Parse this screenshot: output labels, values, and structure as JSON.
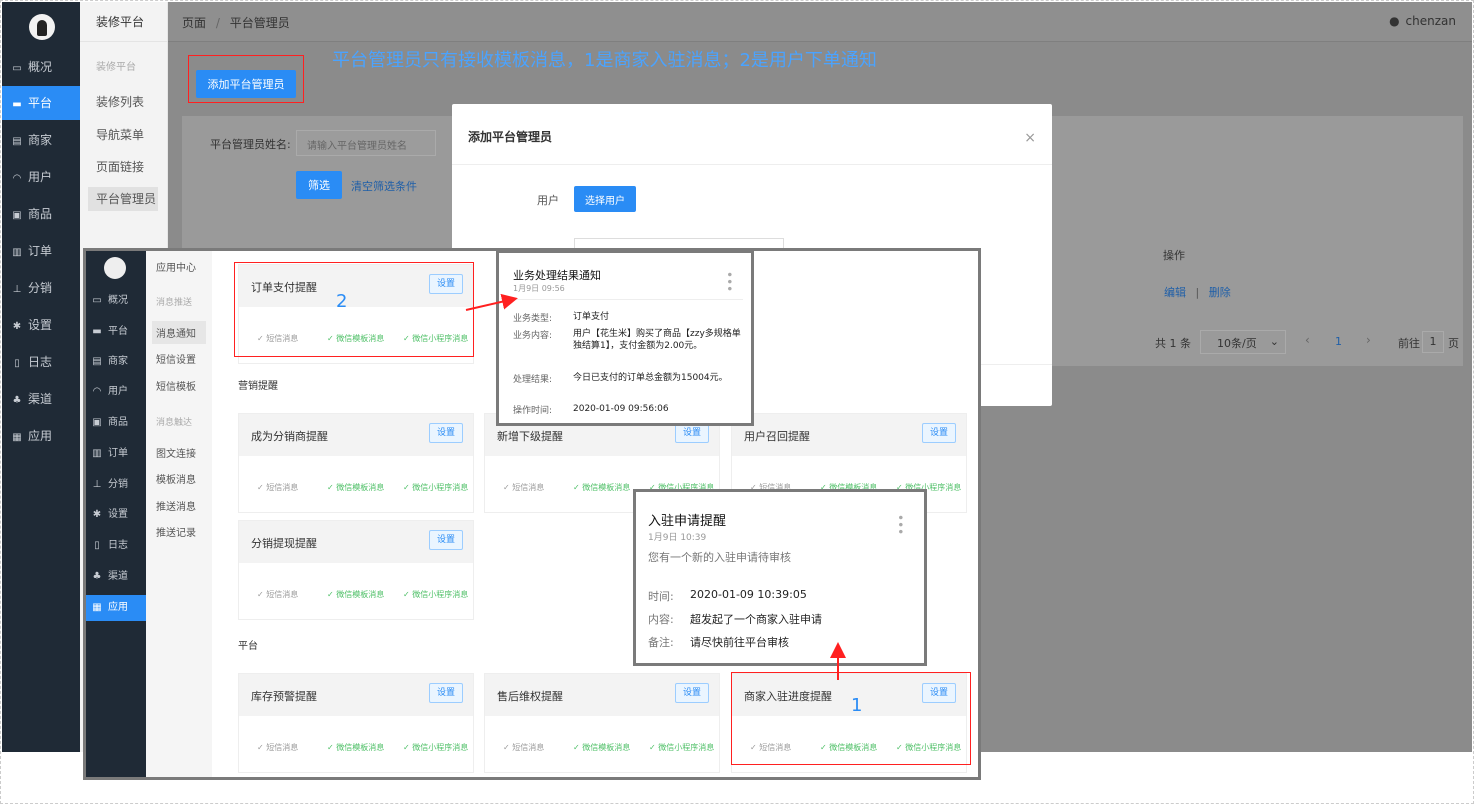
{
  "sidebar": {
    "items": [
      {
        "label": "概况",
        "icon": "monitor-icon"
      },
      {
        "label": "平台",
        "icon": "desktop-icon"
      },
      {
        "label": "商家",
        "icon": "store-icon"
      },
      {
        "label": "用户",
        "icon": "user-icon"
      },
      {
        "label": "商品",
        "icon": "box-icon"
      },
      {
        "label": "订单",
        "icon": "doc-icon"
      },
      {
        "label": "分销",
        "icon": "tree-icon"
      },
      {
        "label": "设置",
        "icon": "gear-icon"
      },
      {
        "label": "日志",
        "icon": "book-icon"
      },
      {
        "label": "渠道",
        "icon": "cluster-icon"
      },
      {
        "label": "应用",
        "icon": "grid-icon"
      }
    ]
  },
  "submenu": {
    "head": "装修平台",
    "group": "装修平台",
    "items": [
      "装修列表",
      "导航菜单",
      "页面链接",
      "平台管理员"
    ]
  },
  "breadcrumb": {
    "home": "页面",
    "sep": "/",
    "current": "平台管理员"
  },
  "user": {
    "name": "chenzan"
  },
  "annotation": "平台管理员只有接收模板消息，1是商家入驻消息；2是用户下单通知",
  "toolbar": {
    "add_label": "添加平台管理员"
  },
  "filter": {
    "label": "平台管理员姓名:",
    "placeholder": "请输入平台管理员姓名",
    "filter_btn": "筛选",
    "clear_btn": "清空筛选条件"
  },
  "table": {
    "op_header": "操作",
    "edit": "编辑",
    "sep": "|",
    "delete": "删除"
  },
  "pager": {
    "total": "共 1 条",
    "size": "10条/页",
    "page": "1",
    "goto": "前往",
    "goto_val": "1",
    "page_unit": "页"
  },
  "modal": {
    "title": "添加平台管理员",
    "user_label": "用户",
    "select_btn": "选择用户",
    "close": "×"
  },
  "inner": {
    "sidebar": [
      {
        "label": "概况",
        "icon": "monitor-icon"
      },
      {
        "label": "平台",
        "icon": "desktop-icon"
      },
      {
        "label": "商家",
        "icon": "store-icon"
      },
      {
        "label": "用户",
        "icon": "user-icon"
      },
      {
        "label": "商品",
        "icon": "box-icon"
      },
      {
        "label": "订单",
        "icon": "doc-icon"
      },
      {
        "label": "分销",
        "icon": "tree-icon"
      },
      {
        "label": "设置",
        "icon": "gear-icon"
      },
      {
        "label": "日志",
        "icon": "book-icon"
      },
      {
        "label": "渠道",
        "icon": "cluster-icon"
      },
      {
        "label": "应用",
        "icon": "grid-icon"
      }
    ],
    "sub": {
      "head": "应用中心",
      "g1": "消息推送",
      "g1items": [
        "消息通知",
        "短信设置",
        "短信模板"
      ],
      "g2": "消息触达",
      "g2items": [
        "图文连接",
        "模板消息",
        "推送消息",
        "推送记录"
      ]
    },
    "sections": {
      "s1": "营销提醒",
      "s2": "平台"
    },
    "set_label": "设置",
    "chan": {
      "sms": "✓ 短信消息",
      "wx": "✓ 微信模板消息",
      "mp": "✓ 微信小程序消息"
    },
    "cards": [
      "订单支付提醒",
      "成为分销商提醒",
      "新增下级提醒",
      "用户召回提醒",
      "分销提现提醒",
      "库存预警提醒",
      "售后维权提醒",
      "商家入驻进度提醒"
    ],
    "num1": "1",
    "num2": "2"
  },
  "notif1": {
    "title": "业务处理结果通知",
    "date": "1月9日 09:56",
    "rows": [
      {
        "k": "业务类型:",
        "v": "订单支付"
      },
      {
        "k": "业务内容:",
        "v": "用户【花生米】购买了商品【zzy多规格单独结算1】，支付金额为2.00元。"
      },
      {
        "k": "处理结果:",
        "v": "今日已支付的订单总金额为15004元。"
      },
      {
        "k": "操作时间:",
        "v": "2020-01-09 09:56:06"
      }
    ]
  },
  "notif2": {
    "title": "入驻申请提醒",
    "date": "1月9日 10:39",
    "summary": "您有一个新的入驻申请待审核",
    "rows": [
      {
        "k": "时间:",
        "v": "2020-01-09 10:39:05"
      },
      {
        "k": "内容:",
        "v": "超发起了一个商家入驻申请"
      },
      {
        "k": "备注:",
        "v": "请尽快前往平台审核"
      }
    ]
  }
}
